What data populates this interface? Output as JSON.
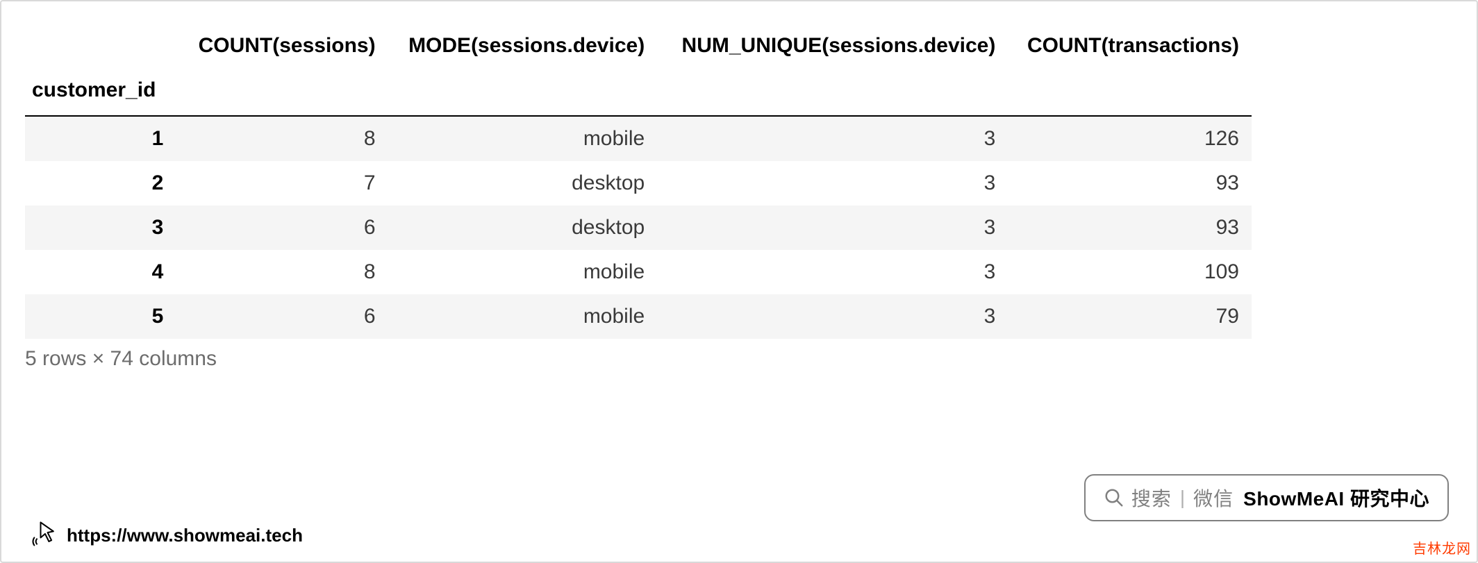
{
  "table": {
    "index_name": "customer_id",
    "columns": [
      "COUNT(sessions)",
      "MODE(sessions.device)",
      "NUM_UNIQUE(sessions.device)",
      "COUNT(transactions)"
    ],
    "rows": [
      {
        "index": "1",
        "cells": [
          "8",
          "mobile",
          "3",
          "126"
        ]
      },
      {
        "index": "2",
        "cells": [
          "7",
          "desktop",
          "3",
          "93"
        ]
      },
      {
        "index": "3",
        "cells": [
          "6",
          "desktop",
          "3",
          "93"
        ]
      },
      {
        "index": "4",
        "cells": [
          "8",
          "mobile",
          "3",
          "109"
        ]
      },
      {
        "index": "5",
        "cells": [
          "6",
          "mobile",
          "3",
          "79"
        ]
      }
    ],
    "shape_text": "5 rows × 74 columns"
  },
  "footer": {
    "url": "https://www.showmeai.tech"
  },
  "watermark": {
    "search_label": "搜索",
    "wechat_label": "微信",
    "brand": "ShowMeAI 研究中心"
  },
  "corner_badge": "吉林龙网"
}
